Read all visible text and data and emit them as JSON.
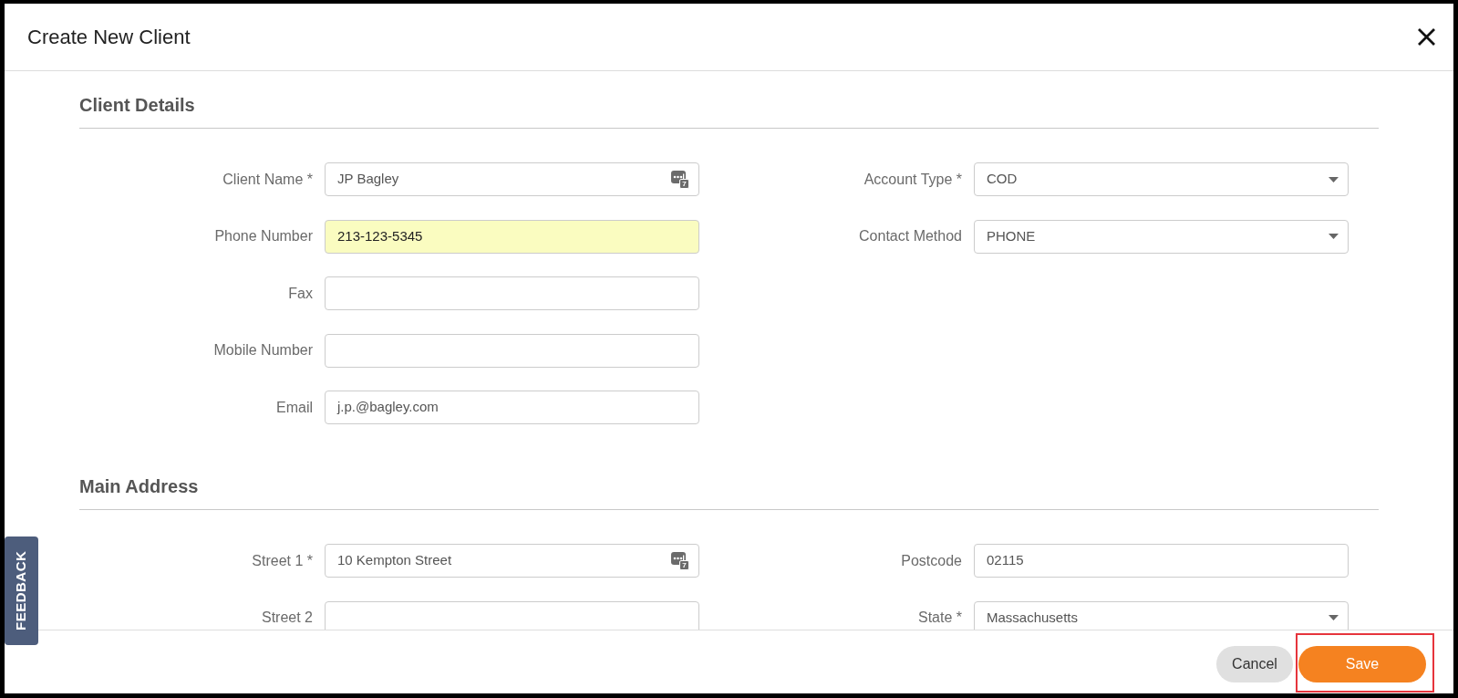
{
  "dialog": {
    "title": "Create New Client"
  },
  "sections": [
    {
      "heading": "Client Details",
      "left_fields": [
        {
          "label": "Client Name *",
          "kind": "text",
          "value": "JP Bagley",
          "autofilled": false,
          "badge": "7"
        },
        {
          "label": "Phone Number",
          "kind": "text",
          "value": "213-123-5345",
          "autofilled": true
        },
        {
          "label": "Fax",
          "kind": "text",
          "autofilled": false
        },
        {
          "label": "Mobile Number",
          "kind": "text",
          "autofilled": false
        },
        {
          "label": "Email",
          "kind": "text",
          "value": "j.p.@bagley.com",
          "autofilled": false
        }
      ],
      "right_fields": [
        {
          "label": "Account Type *",
          "kind": "select",
          "value": "COD",
          "autofilled": false
        },
        {
          "label": "Contact Method",
          "kind": "select",
          "value": "PHONE",
          "autofilled": false
        }
      ]
    },
    {
      "heading": "Main Address",
      "left_fields": [
        {
          "label": "Street 1 *",
          "kind": "text",
          "value": "10 Kempton Street",
          "autofilled": false,
          "badge": "7"
        },
        {
          "label": "Street 2",
          "kind": "text",
          "autofilled": false
        }
      ],
      "right_fields": [
        {
          "label": "Postcode",
          "kind": "text",
          "value": "02115",
          "autofilled": false
        },
        {
          "label": "State *",
          "kind": "select",
          "value": "Massachusetts",
          "autofilled": false
        }
      ]
    }
  ],
  "feedback_tab": {
    "label": "FEEDBACK"
  },
  "footer": {
    "buttons": [
      {
        "label": "Cancel",
        "kind": "secondary",
        "highlighted": false
      },
      {
        "label": "Save",
        "kind": "primary",
        "highlighted": true
      }
    ]
  }
}
